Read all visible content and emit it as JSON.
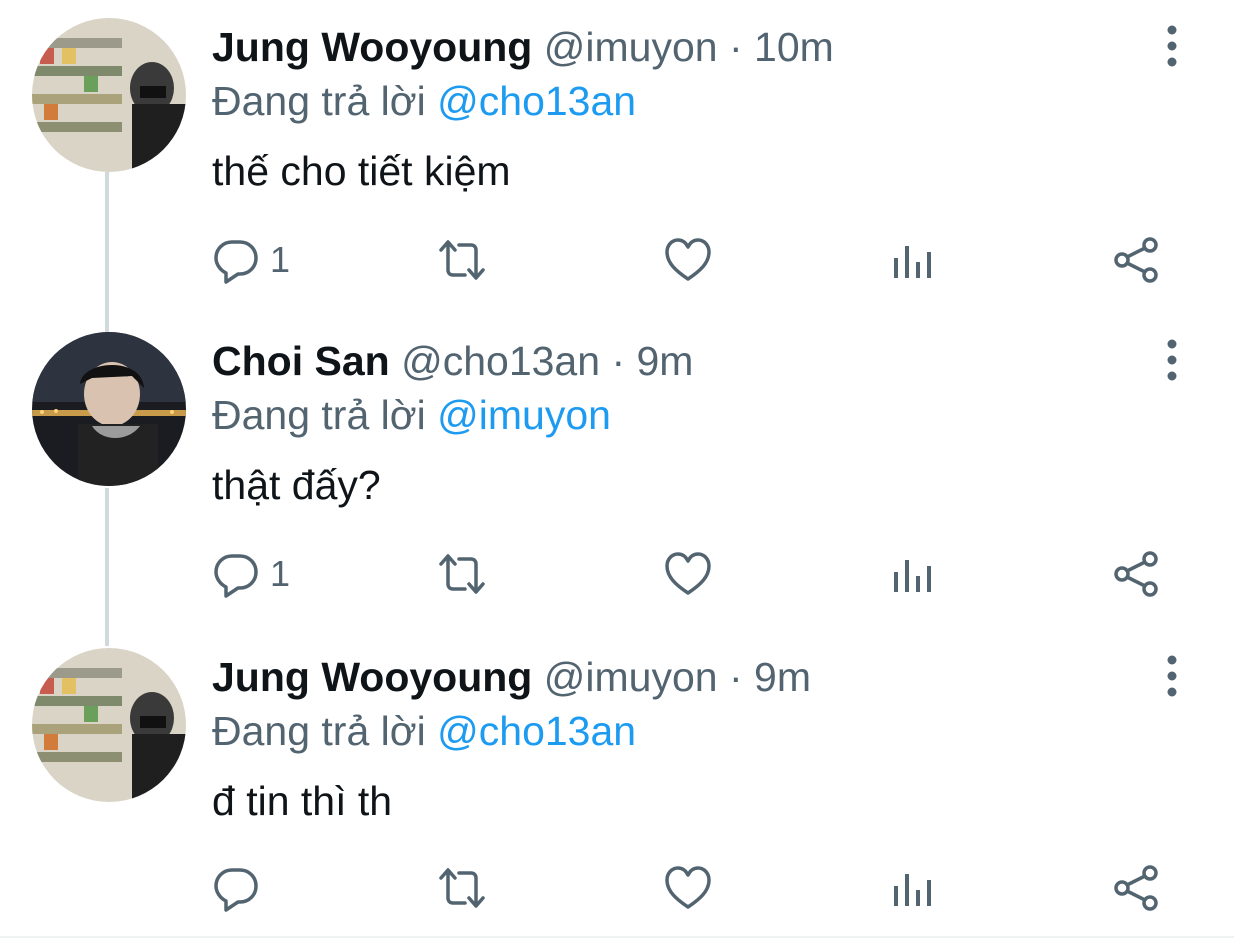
{
  "tweets": [
    {
      "name": "Jung Wooyoung",
      "handle": "@imuyon",
      "separator": "·",
      "time": "10m",
      "reply_prefix": "Đang trả lời",
      "reply_to": "@cho13an",
      "text": "thế cho tiết kiệm",
      "reply_count": "1",
      "avatar": "avatar-store-shelves"
    },
    {
      "name": "Choi San",
      "handle": "@cho13an",
      "separator": "·",
      "time": "9m",
      "reply_prefix": "Đang trả lời",
      "reply_to": "@imuyon",
      "text": "thật đấy?",
      "reply_count": "1",
      "avatar": "avatar-night-river"
    },
    {
      "name": "Jung Wooyoung",
      "handle": "@imuyon",
      "separator": "·",
      "time": "9m",
      "reply_prefix": "Đang trả lời",
      "reply_to": "@cho13an",
      "text": "đ tin thì th",
      "reply_count": "",
      "avatar": "avatar-store-shelves"
    }
  ],
  "icons": {
    "reply": "reply-icon",
    "retweet": "retweet-icon",
    "like": "heart-icon",
    "analytics": "analytics-icon",
    "share": "share-icon",
    "more": "more-vertical-icon"
  },
  "colors": {
    "name": "#0f1419",
    "secondary": "#536471",
    "mention": "#1d9bf0",
    "thread_line": "#cfd9de"
  }
}
